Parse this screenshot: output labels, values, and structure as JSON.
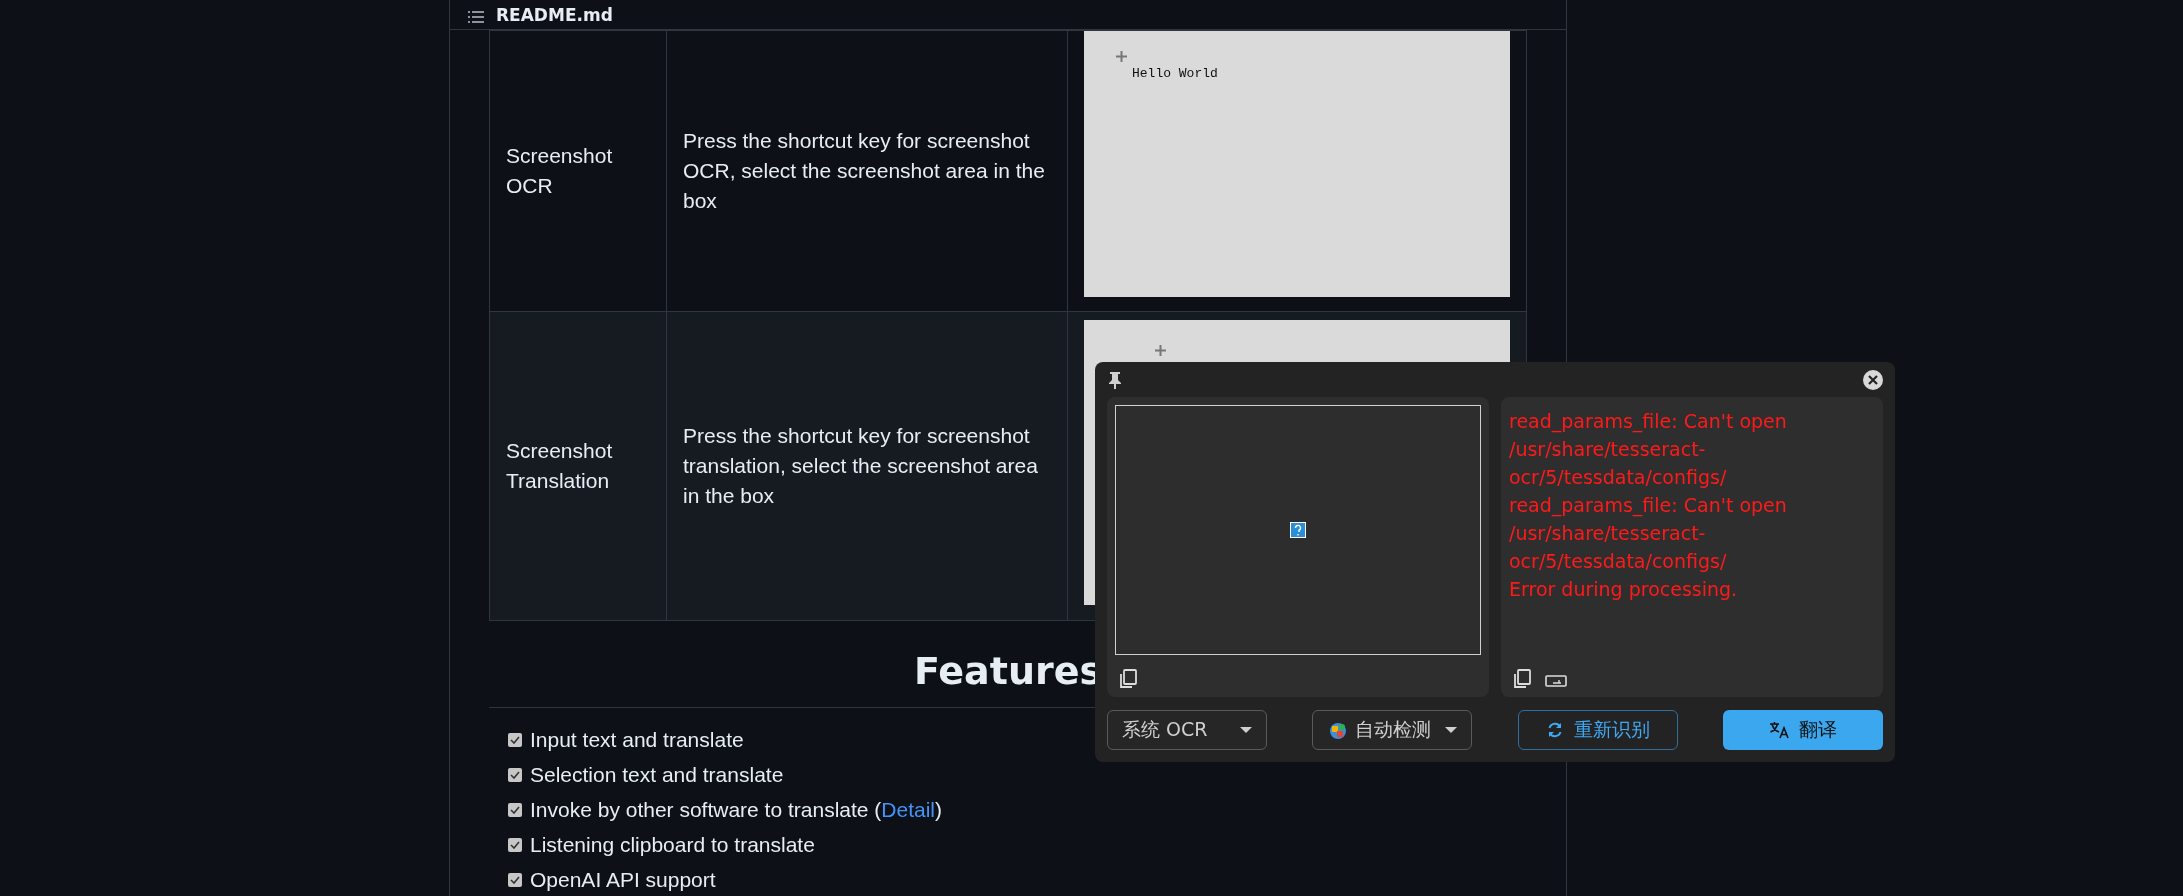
{
  "readme": {
    "title": "README.md"
  },
  "table": {
    "rows": [
      {
        "feature": "Screenshot OCR",
        "description": "Press the shortcut key for screenshot OCR, select the screenshot area in the box",
        "preview": {
          "kind": "screenshot",
          "text": "Hello World"
        }
      },
      {
        "feature": "Screenshot Translation",
        "description": "Press the shortcut key for screenshot translation, select the screenshot area in the box",
        "preview": {
          "kind": "screenshot"
        }
      }
    ]
  },
  "features": {
    "heading": "Features",
    "items": [
      {
        "text": "Input text and translate",
        "checked": true
      },
      {
        "text": "Selection text and translate",
        "checked": true
      },
      {
        "text": "Invoke by other software to translate (",
        "link": "Detail",
        "after": ")",
        "checked": true
      },
      {
        "text": "Listening clipboard to translate",
        "checked": true
      },
      {
        "text": "OpenAI API support",
        "checked": true
      }
    ]
  },
  "popup": {
    "pinned": false,
    "result_lines": [
      "read_params_file: Can't open /usr/share/tesseract-ocr/5/tessdata/configs/",
      "read_params_file: Can't open /usr/share/tesseract-ocr/5/tessdata/configs/",
      "Error during processing."
    ],
    "error": true,
    "controls": [
      {
        "kind": "dropdown",
        "label": "系统 OCR"
      },
      {
        "kind": "language-dropdown",
        "label": "自动检测"
      },
      {
        "kind": "outline",
        "label": "重新识别"
      },
      {
        "kind": "primary",
        "label": "翻译"
      }
    ]
  }
}
